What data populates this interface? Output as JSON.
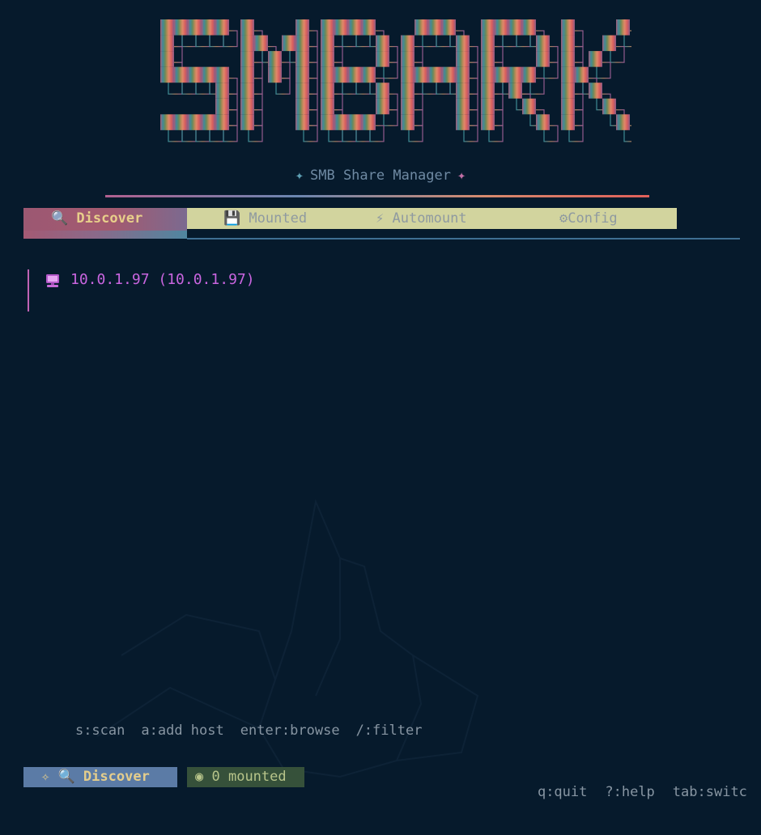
{
  "logo": {
    "text": "SMBARK"
  },
  "subtitle": {
    "star": "✦",
    "text": "SMB Share Manager"
  },
  "tabs": [
    {
      "icon": "🔍",
      "label": "Discover",
      "active": true
    },
    {
      "icon": "💾",
      "label": "Mounted",
      "active": false
    },
    {
      "icon": "⚡",
      "label": "Automount",
      "active": false
    },
    {
      "icon": "⚙",
      "label": "Config",
      "active": false
    }
  ],
  "hosts": [
    {
      "label": "10.0.1.97 (10.0.1.97)"
    }
  ],
  "keyhints": [
    "s:scan",
    "a:add host",
    "enter:browse",
    "/:filter"
  ],
  "status": {
    "mode_prefix": "✧",
    "mode_icon": "🔍",
    "mode_label": "Discover",
    "mounted_icon": "◉",
    "mounted_label": "0 mounted",
    "right_hints": [
      "q:quit",
      "?:help",
      "tab:switc"
    ]
  },
  "colors": {
    "background": "#061a2c",
    "accent_pink": "#c965df",
    "tab_strip": "#d2d49e",
    "tab_active": "#a35a70",
    "status_mode": "#5b7ba6",
    "status_mounted": "#36513a"
  }
}
